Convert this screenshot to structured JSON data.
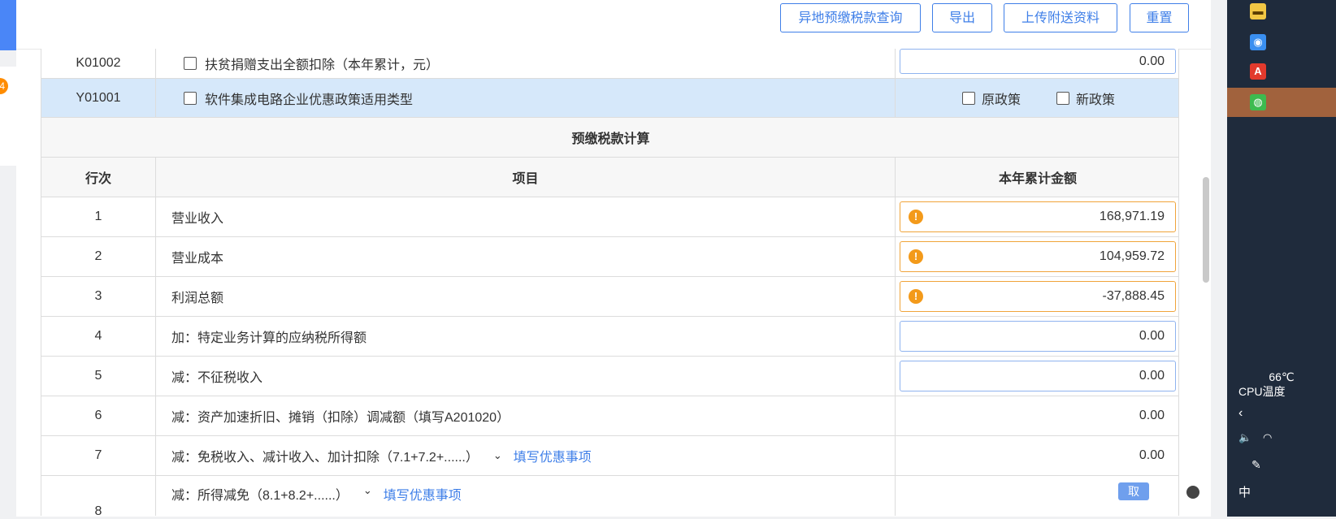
{
  "toolbar": {
    "buttons": [
      "异地预缴税款查询",
      "导出",
      "上传附送资料",
      "重置"
    ]
  },
  "left": {
    "badge": "4"
  },
  "rows_top": [
    {
      "code": "K01002",
      "label": "扶贫捐赠支出全额扣除（本年累计，元）",
      "value": "0.00"
    },
    {
      "code": "Y01001",
      "label": "软件集成电路企业优惠政策适用类型",
      "opt1": "原政策",
      "opt2": "新政策"
    }
  ],
  "section_title": "预缴税款计算",
  "headers": {
    "no": "行次",
    "item": "项目",
    "amount": "本年累计金额"
  },
  "rows": [
    {
      "no": "1",
      "item": "营业收入",
      "value": "168,971.19"
    },
    {
      "no": "2",
      "item": "营业成本",
      "value": "104,959.72"
    },
    {
      "no": "3",
      "item": "利润总额",
      "value": "-37,888.45"
    },
    {
      "no": "4",
      "item": "加：特定业务计算的应纳税所得额",
      "value": "0.00"
    },
    {
      "no": "5",
      "item": "减：不征税收入",
      "value": "0.00"
    },
    {
      "no": "6",
      "item": "减：资产加速折旧、摊销（扣除）调减额（填写A201020）",
      "value": "0.00"
    },
    {
      "no": "7",
      "item": "减：免税收入、减计收入、加计扣除（7.1+7.2+......）",
      "value": "0.00",
      "link": "填写优惠事项"
    },
    {
      "no": "8",
      "item": "减：所得减免（8.1+8.2+......）",
      "link": "填写优惠事项"
    }
  ],
  "taskbar": {
    "temp": "66℃",
    "cpu": "CPU温度",
    "ime": "中"
  },
  "overlay": "取"
}
